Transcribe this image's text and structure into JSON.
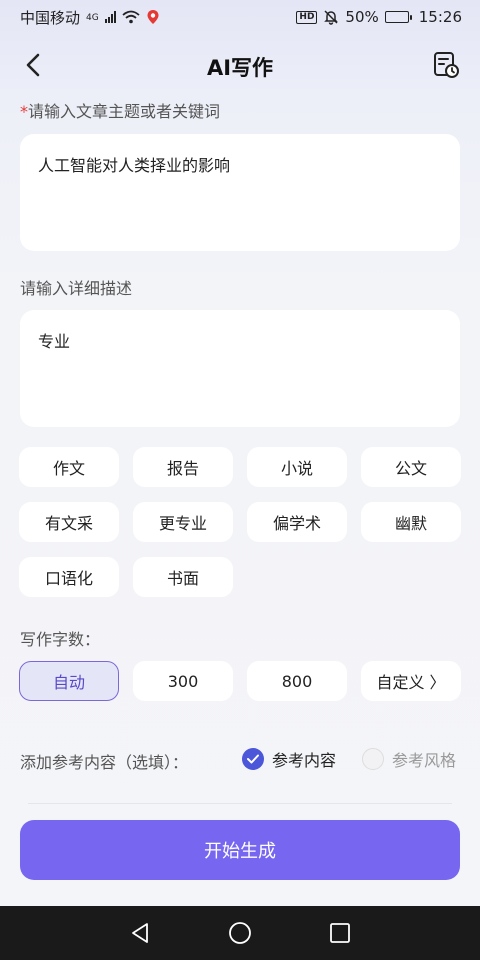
{
  "status_bar": {
    "carrier": "中国移动",
    "network": "4G",
    "battery": "50%",
    "battery_level": 0.5,
    "time": "15:26"
  },
  "header": {
    "title": "AI写作"
  },
  "topic": {
    "required_mark": "*",
    "label": "请输入文章主题或者关键词",
    "value": "人工智能对人类择业的影响"
  },
  "description": {
    "label": "请输入详细描述",
    "value": "专业"
  },
  "styles": [
    {
      "label": "作文"
    },
    {
      "label": "报告"
    },
    {
      "label": "小说"
    },
    {
      "label": "公文"
    },
    {
      "label": "有文采"
    },
    {
      "label": "更专业"
    },
    {
      "label": "偏学术"
    },
    {
      "label": "幽默"
    },
    {
      "label": "口语化"
    },
    {
      "label": "书面"
    }
  ],
  "word_count": {
    "label": "写作字数：",
    "options": [
      {
        "label": "自动",
        "selected": true
      },
      {
        "label": "300",
        "selected": false
      },
      {
        "label": "800",
        "selected": false
      },
      {
        "label": "自定义 〉",
        "selected": false
      }
    ]
  },
  "reference": {
    "label": "添加参考内容（选填）：",
    "options": [
      {
        "label": "参考内容",
        "checked": true
      },
      {
        "label": "参考风格",
        "checked": false
      }
    ]
  },
  "submit": {
    "label": "开始生成"
  },
  "colors": {
    "accent": "#7766f0",
    "radio_on": "#4b56d9",
    "required": "#e53935"
  }
}
